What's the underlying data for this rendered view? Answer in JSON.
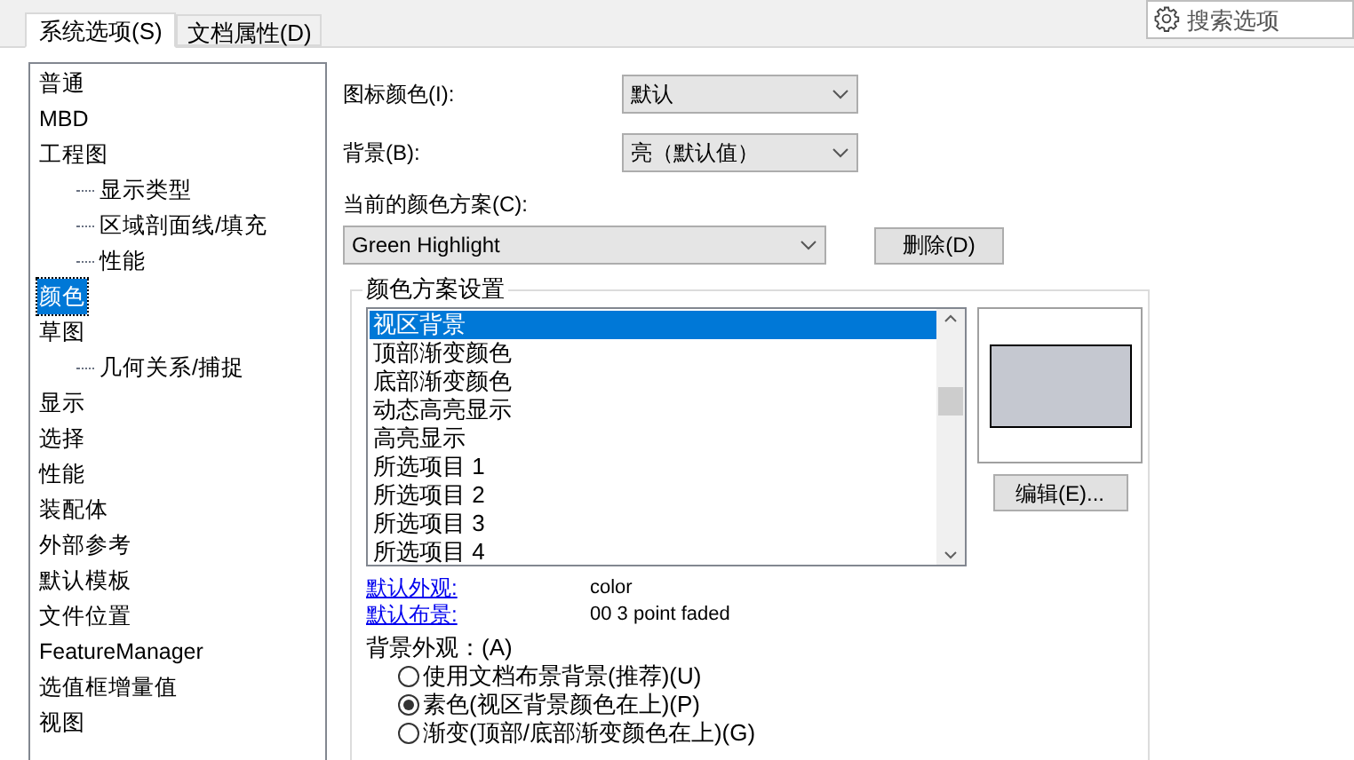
{
  "tabs": [
    {
      "label": "系统选项(S)",
      "selected": true
    },
    {
      "label": "文档属性(D)",
      "selected": false
    }
  ],
  "search": {
    "placeholder": "搜索选项"
  },
  "tree": [
    {
      "label": "普通",
      "selected": false
    },
    {
      "label": "MBD",
      "selected": false
    },
    {
      "label": "工程图",
      "selected": false,
      "children": [
        {
          "label": "显示类型",
          "selected": false
        },
        {
          "label": "区域剖面线/填充",
          "selected": false
        },
        {
          "label": "性能",
          "selected": false
        }
      ]
    },
    {
      "label": "颜色",
      "selected": true
    },
    {
      "label": "草图",
      "selected": false,
      "children": [
        {
          "label": "几何关系/捕捉",
          "selected": false
        }
      ]
    },
    {
      "label": "显示",
      "selected": false
    },
    {
      "label": "选择",
      "selected": false
    },
    {
      "label": "性能",
      "selected": false
    },
    {
      "label": "装配体",
      "selected": false
    },
    {
      "label": "外部参考",
      "selected": false
    },
    {
      "label": "默认模板",
      "selected": false
    },
    {
      "label": "文件位置",
      "selected": false
    },
    {
      "label": "FeatureManager",
      "selected": false
    },
    {
      "label": "选值框增量值",
      "selected": false
    },
    {
      "label": "视图",
      "selected": false
    }
  ],
  "icon_color": {
    "label": "图标颜色(I):",
    "value": "默认"
  },
  "background": {
    "label": "背景(B):",
    "value": "亮（默认值）"
  },
  "scheme": {
    "label": "当前的颜色方案(C):",
    "value": "Green Highlight",
    "delete_button": "删除(D)"
  },
  "scheme_settings": {
    "title": "颜色方案设置",
    "items": [
      {
        "label": "视区背景",
        "selected": true
      },
      {
        "label": "顶部渐变颜色",
        "selected": false
      },
      {
        "label": "底部渐变颜色",
        "selected": false
      },
      {
        "label": "动态高亮显示",
        "selected": false
      },
      {
        "label": "高亮显示",
        "selected": false
      },
      {
        "label": "所选项目 1",
        "selected": false
      },
      {
        "label": "所选项目 2",
        "selected": false
      },
      {
        "label": "所选项目 3",
        "selected": false
      },
      {
        "label": "所选项目 4",
        "selected": false
      }
    ],
    "edit_button": "编辑(E)...",
    "links": [
      {
        "label": "默认外观:",
        "value": "color"
      },
      {
        "label": "默认布景:",
        "value": "00 3 point faded"
      }
    ],
    "appearance_label": "背景外观：(A)",
    "radios": [
      {
        "label": "使用文档布景背景(推荐)(U)",
        "selected": false
      },
      {
        "label": "素色(视区背景颜色在上)(P)",
        "selected": true
      },
      {
        "label": "渐变(顶部/底部渐变颜色在上)(G)",
        "selected": false
      }
    ]
  }
}
